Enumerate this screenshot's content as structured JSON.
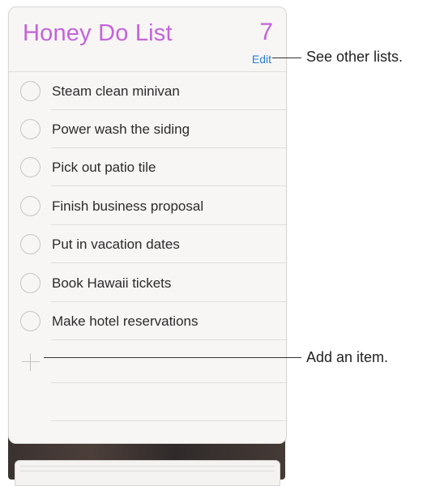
{
  "list": {
    "title": "Honey Do List",
    "count": "7",
    "edit_label": "Edit",
    "accent_color": "#c463dc",
    "items": [
      {
        "label": "Steam clean minivan",
        "completed": false
      },
      {
        "label": "Power wash the siding",
        "completed": false
      },
      {
        "label": "Pick out patio tile",
        "completed": false
      },
      {
        "label": "Finish business proposal",
        "completed": false
      },
      {
        "label": "Put in vacation dates",
        "completed": false
      },
      {
        "label": "Book Hawaii tickets",
        "completed": false
      },
      {
        "label": "Make hotel reservations",
        "completed": false
      }
    ],
    "add_icon": "plus-icon"
  },
  "callouts": {
    "edit": "See other lists.",
    "add": "Add an item."
  }
}
